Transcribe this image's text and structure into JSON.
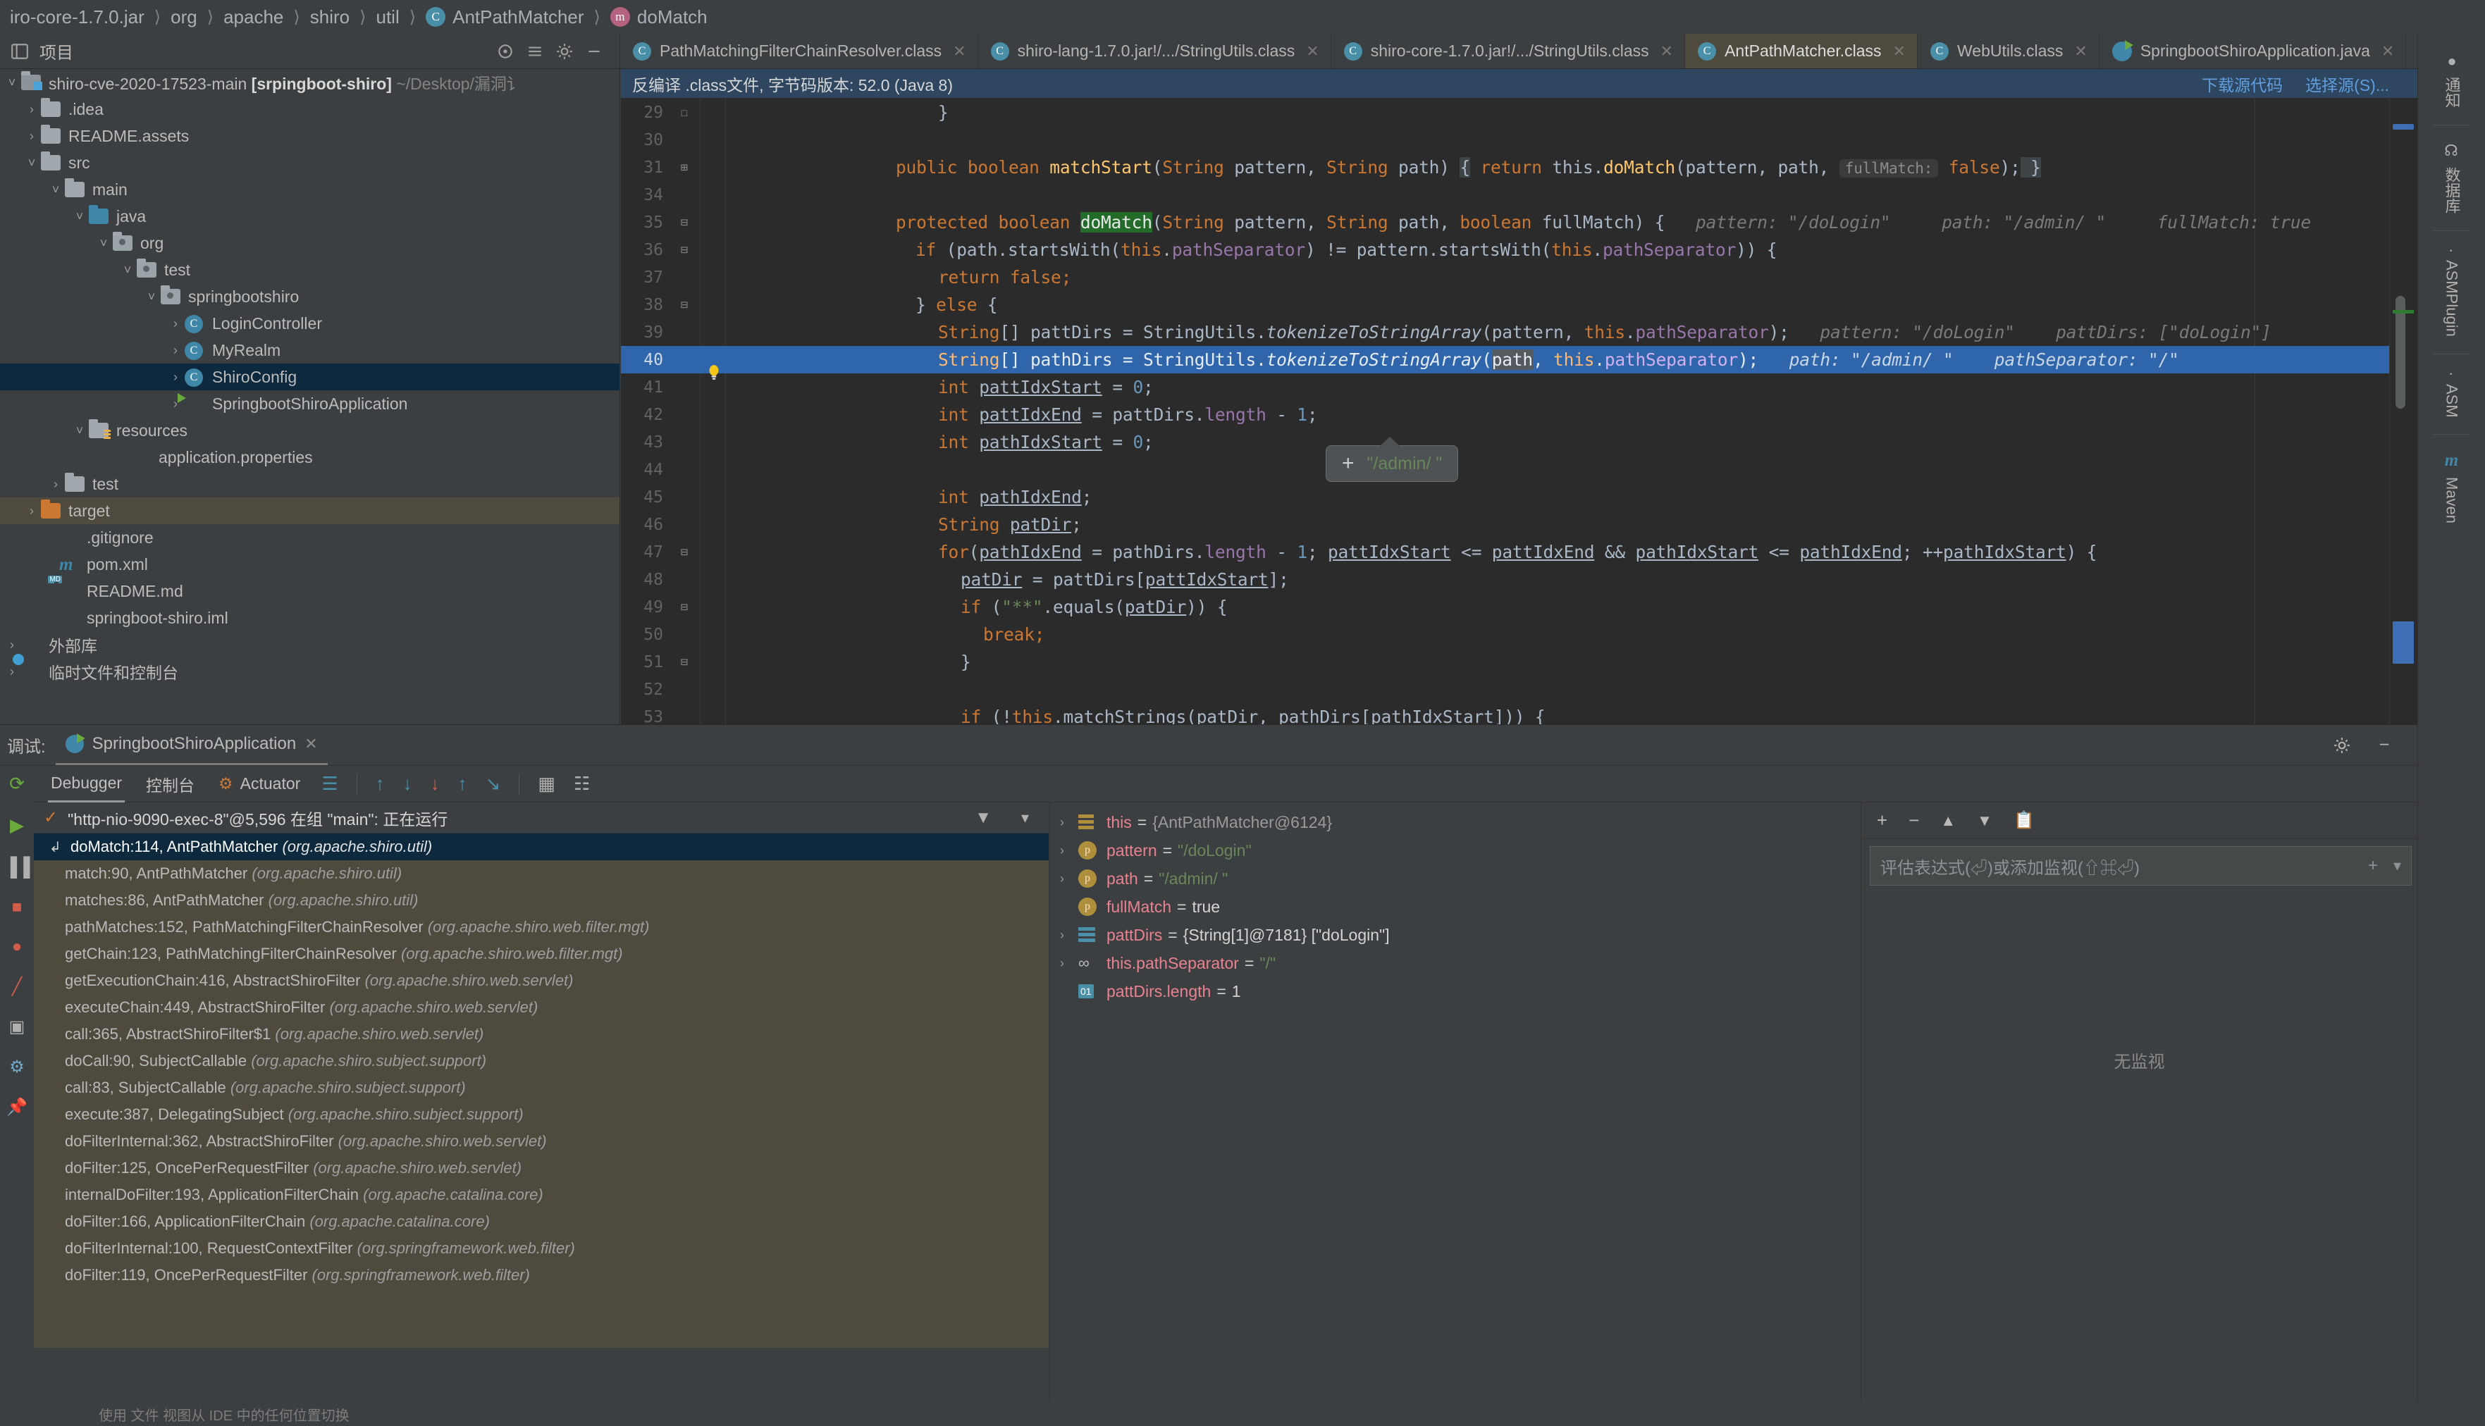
{
  "breadcrumb": {
    "items": [
      {
        "label": "iro-core-1.7.0.jar",
        "icon": "jar-icon"
      },
      {
        "label": "org",
        "icon": "package-icon"
      },
      {
        "label": "apache",
        "icon": "package-icon"
      },
      {
        "label": "shiro",
        "icon": "package-icon"
      },
      {
        "label": "util",
        "icon": "package-icon"
      },
      {
        "label": "AntPathMatcher",
        "icon": "class-icon"
      },
      {
        "label": "doMatch",
        "icon": "method-icon"
      }
    ]
  },
  "project_tool": {
    "title": "项目"
  },
  "tabs": [
    {
      "label": "PathMatchingFilterChainResolver.class",
      "icon": "class-icon",
      "active": false
    },
    {
      "label": "shiro-lang-1.7.0.jar!/.../StringUtils.class",
      "icon": "class-icon",
      "active": false
    },
    {
      "label": "shiro-core-1.7.0.jar!/.../StringUtils.class",
      "icon": "class-icon",
      "active": false
    },
    {
      "label": "AntPathMatcher.class",
      "icon": "class-icon",
      "active": true
    },
    {
      "label": "WebUtils.class",
      "icon": "class-icon",
      "active": false
    },
    {
      "label": "SpringbootShiroApplication.java",
      "icon": "spring-icon",
      "active": false
    }
  ],
  "sidebar": {
    "items": [
      {
        "label": "shiro-cve-2020-17523-main",
        "bold": " [srpingboot-shiro]",
        "dim": " ~/Desktop/漏洞讠",
        "arrow": "v",
        "icon": "module-icon",
        "indent": 0,
        "state": "none"
      },
      {
        "label": ".idea",
        "arrow": ">",
        "icon": "folder-icon",
        "indent": 1,
        "state": "none"
      },
      {
        "label": "README.assets",
        "arrow": ">",
        "icon": "folder-icon",
        "indent": 1,
        "state": "none"
      },
      {
        "label": "src",
        "arrow": "v",
        "icon": "folder-icon",
        "indent": 1,
        "state": "none"
      },
      {
        "label": "main",
        "arrow": "v",
        "icon": "folder-icon",
        "indent": 2,
        "state": "none"
      },
      {
        "label": "java",
        "arrow": "v",
        "icon": "source-folder-icon",
        "indent": 3,
        "state": "none"
      },
      {
        "label": "org",
        "arrow": "v",
        "icon": "package-folder-icon",
        "indent": 4,
        "state": "none"
      },
      {
        "label": "test",
        "arrow": "v",
        "icon": "package-folder-icon",
        "indent": 5,
        "state": "none"
      },
      {
        "label": "springbootshiro",
        "arrow": "v",
        "icon": "package-folder-icon",
        "indent": 6,
        "state": "none"
      },
      {
        "label": "LoginController",
        "arrow": ">",
        "icon": "java-class-icon",
        "indent": 7,
        "state": "none"
      },
      {
        "label": "MyRealm",
        "arrow": ">",
        "icon": "java-class-icon",
        "indent": 7,
        "state": "none"
      },
      {
        "label": "ShiroConfig",
        "arrow": ">",
        "icon": "java-class-icon",
        "indent": 7,
        "state": "selected"
      },
      {
        "label": "SpringbootShiroApplication",
        "arrow": ">",
        "icon": "spring-boot-icon",
        "indent": 7,
        "state": "none"
      },
      {
        "label": "resources",
        "arrow": "v",
        "icon": "resources-folder-icon",
        "indent": 3,
        "state": "none"
      },
      {
        "label": "application.properties",
        "arrow": "",
        "icon": "properties-icon",
        "indent": 4,
        "state": "none"
      },
      {
        "label": "test",
        "arrow": ">",
        "icon": "folder-icon",
        "indent": 2,
        "state": "none"
      },
      {
        "label": "target",
        "arrow": ">",
        "icon": "excluded-folder-icon",
        "indent": 1,
        "state": "hover"
      },
      {
        "label": ".gitignore",
        "arrow": "",
        "icon": "gitignore-icon",
        "indent": 1,
        "state": "none"
      },
      {
        "label": "pom.xml",
        "arrow": "",
        "icon": "maven-icon",
        "indent": 1,
        "state": "none"
      },
      {
        "label": "README.md",
        "arrow": "",
        "icon": "markdown-icon",
        "indent": 1,
        "state": "none"
      },
      {
        "label": "springboot-shiro.iml",
        "arrow": "",
        "icon": "iml-icon",
        "indent": 1,
        "state": "none"
      },
      {
        "label": "外部库",
        "arrow": ">",
        "icon": "external-libraries-icon",
        "indent": 0,
        "state": "none"
      },
      {
        "label": "临时文件和控制台",
        "arrow": ">",
        "icon": "scratches-icon",
        "indent": 0,
        "state": "none"
      }
    ]
  },
  "editor": {
    "notification": "反编译 .class文件, 字节码版本: 52.0 (Java 8)",
    "actions": [
      "下载源代码",
      "选择源(S)..."
    ],
    "tooltip": {
      "plus": "+",
      "value": "\"/admin/ \""
    },
    "lines": [
      {
        "num": "29",
        "fold": "-"
      },
      {
        "num": "30",
        "fold": ""
      },
      {
        "num": "31",
        "fold": "+"
      },
      {
        "num": "34",
        "fold": ""
      },
      {
        "num": "35",
        "fold": "-"
      },
      {
        "num": "36",
        "fold": "-"
      },
      {
        "num": "37",
        "fold": ""
      },
      {
        "num": "38",
        "fold": "-"
      },
      {
        "num": "39",
        "fold": ""
      },
      {
        "num": "40",
        "fold": "",
        "highlighted": true
      },
      {
        "num": "41",
        "fold": ""
      },
      {
        "num": "42",
        "fold": ""
      },
      {
        "num": "43",
        "fold": ""
      },
      {
        "num": "44",
        "fold": ""
      },
      {
        "num": "45",
        "fold": ""
      },
      {
        "num": "46",
        "fold": ""
      },
      {
        "num": "47",
        "fold": "-"
      },
      {
        "num": "48",
        "fold": ""
      },
      {
        "num": "49",
        "fold": "-"
      },
      {
        "num": "50",
        "fold": ""
      },
      {
        "num": "51",
        "fold": "-"
      },
      {
        "num": "52",
        "fold": ""
      },
      {
        "num": "53",
        "fold": ""
      }
    ],
    "code": {
      "l29": "}",
      "l31": "public boolean matchStart(String pattern, String path) { return this.doMatch(pattern, path,  fullMatch: false); }",
      "l35": "protected boolean doMatch(String pattern, String path, boolean fullMatch) {",
      "l35_hints": "pattern: \"/doLogin\"    path: \"/admin/ \"    fullMatch: true",
      "l36": "if (path.startsWith(this.pathSeparator) != pattern.startsWith(this.pathSeparator)) {",
      "l37": "return false;",
      "l38": "} else {",
      "l39": "String[] pattDirs = StringUtils.tokenizeToStringArray(pattern, this.pathSeparator);",
      "l39_hints": "pattern: \"/doLogin\"     pattDirs: [\"doLogin\"]",
      "l40": "String[] pathDirs = StringUtils.tokenizeToStringArray(path, this.pathSeparator);",
      "l40_hints": "path: \"/admin/ \"     pathSeparator: \"/\"",
      "l41": "int pattIdxStart = 0;",
      "l42": "int pattIdxEnd = pattDirs.length - 1;",
      "l43": "int pathIdxStart = 0;",
      "l45": "int pathIdxEnd;",
      "l46": "String patDir;",
      "l47": "for(pathIdxEnd = pathDirs.length - 1; pattIdxStart <= pattIdxEnd && pathIdxStart <= pathIdxEnd; ++pathIdxStart) {",
      "l48": "patDir = pattDirs[pattIdxStart];",
      "l49": "if (\"**\".equals(patDir)) {",
      "l50": "break;",
      "l51": "}",
      "l53": "if (!this.matchStrings(patDir, pathDirs[pathIdxStart])) {"
    }
  },
  "right_rail": {
    "items": [
      {
        "label": "通知",
        "icon": "notifications-icon"
      },
      {
        "label": "数据库",
        "icon": "database-icon"
      },
      {
        "label": "ASMPlugin",
        "icon": "asm-plugin-icon"
      },
      {
        "label": "ASM",
        "icon": "asm-icon"
      },
      {
        "label": "Maven",
        "icon": "maven-icon"
      }
    ]
  },
  "debug": {
    "header_label": "调试:",
    "config_name": "SpringbootShiroApplication",
    "toolbar_tabs": [
      {
        "label": "Debugger",
        "active": true
      },
      {
        "label": "控制台",
        "active": false
      },
      {
        "label": "Actuator",
        "active": false
      }
    ],
    "thread_status": "\"http-nio-9090-exec-8\"@5,596 在组 \"main\": 正在运行",
    "frames": [
      {
        "label": "doMatch:114, AntPathMatcher",
        "pkg": "(org.apache.shiro.util)",
        "selected": true
      },
      {
        "label": "match:90, AntPathMatcher",
        "pkg": "(org.apache.shiro.util)",
        "selected": false
      },
      {
        "label": "matches:86, AntPathMatcher",
        "pkg": "(org.apache.shiro.util)",
        "selected": false
      },
      {
        "label": "pathMatches:152, PathMatchingFilterChainResolver",
        "pkg": "(org.apache.shiro.web.filter.mgt)",
        "selected": false
      },
      {
        "label": "getChain:123, PathMatchingFilterChainResolver",
        "pkg": "(org.apache.shiro.web.filter.mgt)",
        "selected": false
      },
      {
        "label": "getExecutionChain:416, AbstractShiroFilter",
        "pkg": "(org.apache.shiro.web.servlet)",
        "selected": false
      },
      {
        "label": "executeChain:449, AbstractShiroFilter",
        "pkg": "(org.apache.shiro.web.servlet)",
        "selected": false
      },
      {
        "label": "call:365, AbstractShiroFilter$1",
        "pkg": "(org.apache.shiro.web.servlet)",
        "selected": false
      },
      {
        "label": "doCall:90, SubjectCallable",
        "pkg": "(org.apache.shiro.subject.support)",
        "selected": false
      },
      {
        "label": "call:83, SubjectCallable",
        "pkg": "(org.apache.shiro.subject.support)",
        "selected": false
      },
      {
        "label": "execute:387, DelegatingSubject",
        "pkg": "(org.apache.shiro.subject.support)",
        "selected": false
      },
      {
        "label": "doFilterInternal:362, AbstractShiroFilter",
        "pkg": "(org.apache.shiro.web.servlet)",
        "selected": false
      },
      {
        "label": "doFilter:125, OncePerRequestFilter",
        "pkg": "(org.apache.shiro.web.servlet)",
        "selected": false
      },
      {
        "label": "internalDoFilter:193, ApplicationFilterChain",
        "pkg": "(org.apache.catalina.core)",
        "selected": false
      },
      {
        "label": "doFilter:166, ApplicationFilterChain",
        "pkg": "(org.apache.catalina.core)",
        "selected": false
      },
      {
        "label": "doFilterInternal:100, RequestContextFilter",
        "pkg": "(org.springframework.web.filter)",
        "selected": false
      },
      {
        "label": "doFilter:119, OncePerRequestFilter",
        "pkg": "(org.springframework.web.filter)",
        "selected": false
      }
    ],
    "variables": [
      {
        "arrow": ">",
        "icon": "object-icon",
        "name": "this",
        "value": "{AntPathMatcher@6124}",
        "value_kind": "ref"
      },
      {
        "arrow": ">",
        "icon": "parameter-icon",
        "name": "pattern",
        "value": "\"/doLogin\"",
        "value_kind": "str"
      },
      {
        "arrow": ">",
        "icon": "parameter-icon",
        "name": "path",
        "value": "\"/admin/ \"",
        "value_kind": "str"
      },
      {
        "arrow": "",
        "icon": "parameter-icon",
        "name": "fullMatch",
        "value": "true",
        "value_kind": "plain"
      },
      {
        "arrow": ">",
        "icon": "array-icon",
        "name": "pattDirs",
        "value": "{String[1]@7181} [\"doLogin\"]",
        "value_kind": "mixed"
      },
      {
        "arrow": ">",
        "icon": "field-icon",
        "name": "this.pathSeparator",
        "value": "\"/\"",
        "value_kind": "str"
      },
      {
        "arrow": "",
        "icon": "number-icon",
        "name": "pattDirs.length",
        "value": "1",
        "value_kind": "plain"
      }
    ],
    "watches": {
      "placeholder": "评估表达式(⏎)或添加监视(⇧⌘⏎)",
      "empty_text": "无监视"
    },
    "status_hint": "使用 文件 视图从 IDE 中的任何位置切换"
  },
  "colors": {
    "accent_blue": "#2f65ab",
    "selection_navy": "#0d293e",
    "hover_olive": "#4e4a3d",
    "keyword_orange": "#cc7832",
    "string_green": "#6a8759",
    "number_blue": "#6897bb",
    "method_yellow": "#ffc66d",
    "field_purple": "#9876aa",
    "panel_bg": "#3c3f41",
    "editor_bg": "#2b2b2b"
  }
}
